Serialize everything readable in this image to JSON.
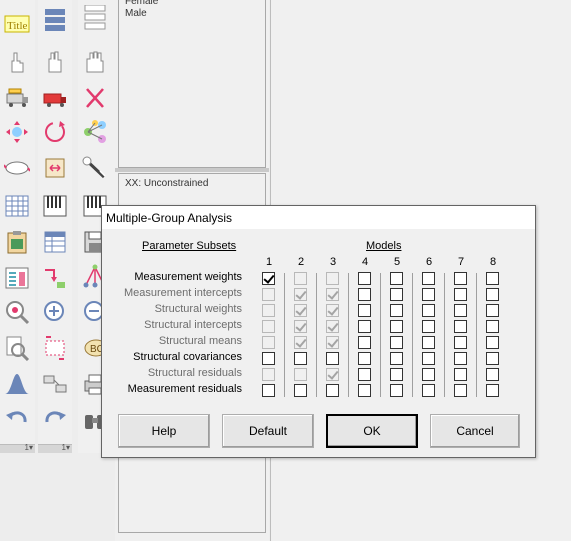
{
  "toolbox": {
    "column1_icons": [
      "title-icon",
      "hand-one-finger-icon",
      "truck-icon",
      "move-arrows-icon",
      "oval-icon",
      "table-icon",
      "clipboard-icon",
      "data-list-icon",
      "zoom-in-icon",
      "zoom-page-icon",
      "normal-curve-icon",
      "undo-icon"
    ],
    "column2_icons": [
      "list-icon",
      "hand-two-fingers-icon",
      "truck-red-icon",
      "rotate-icon",
      "scroll-icon",
      "piano-keys-icon",
      "data-sheet-icon",
      "arrows-icon",
      "zoom-plus-icon",
      "resize-icon",
      "drag-icon",
      "redo-icon"
    ],
    "column3_icons": [
      "list-icon",
      "hand-four-fingers-icon",
      "cross-icon",
      "network-icon",
      "magic-wand-icon",
      "piano-keys-icon",
      "save-icon",
      "multiple-group-icon",
      "zoom-out-icon",
      "bc-icon",
      "printer-icon",
      "binoculars-icon"
    ],
    "footer_marker": "1▾"
  },
  "variables_panel": {
    "items": [
      "Female",
      "Male"
    ]
  },
  "models_panel": {
    "label": "XX: Unconstrained"
  },
  "dialog": {
    "title": "Multiple-Group Analysis",
    "parameter_subsets_header": "Parameter Subsets",
    "models_header": "Models",
    "model_numbers": [
      "1",
      "2",
      "3",
      "4",
      "5",
      "6",
      "7",
      "8"
    ],
    "rows": [
      {
        "label": "Measurement weights",
        "enabled": true,
        "checks": [
          true,
          false,
          false,
          false,
          false,
          false,
          false,
          false
        ],
        "disabled": [
          false,
          true,
          true,
          false,
          false,
          false,
          false,
          false
        ]
      },
      {
        "label": "Measurement intercepts",
        "enabled": false,
        "checks": [
          false,
          true,
          true,
          false,
          false,
          false,
          false,
          false
        ],
        "disabled": [
          true,
          true,
          true,
          false,
          false,
          false,
          false,
          false
        ]
      },
      {
        "label": "Structural weights",
        "enabled": false,
        "checks": [
          false,
          true,
          true,
          false,
          false,
          false,
          false,
          false
        ],
        "disabled": [
          true,
          true,
          true,
          false,
          false,
          false,
          false,
          false
        ]
      },
      {
        "label": "Structural intercepts",
        "enabled": false,
        "checks": [
          false,
          true,
          true,
          false,
          false,
          false,
          false,
          false
        ],
        "disabled": [
          true,
          true,
          true,
          false,
          false,
          false,
          false,
          false
        ]
      },
      {
        "label": "Structural means",
        "enabled": false,
        "checks": [
          false,
          true,
          true,
          false,
          false,
          false,
          false,
          false
        ],
        "disabled": [
          true,
          true,
          true,
          false,
          false,
          false,
          false,
          false
        ]
      },
      {
        "label": "Structural covariances",
        "enabled": true,
        "checks": [
          false,
          false,
          false,
          false,
          false,
          false,
          false,
          false
        ],
        "disabled": [
          false,
          false,
          false,
          false,
          false,
          false,
          false,
          false
        ]
      },
      {
        "label": "Structural residuals",
        "enabled": false,
        "checks": [
          false,
          false,
          true,
          false,
          false,
          false,
          false,
          false
        ],
        "disabled": [
          true,
          true,
          true,
          false,
          false,
          false,
          false,
          false
        ]
      },
      {
        "label": "Measurement residuals",
        "enabled": true,
        "checks": [
          false,
          false,
          false,
          false,
          false,
          false,
          false,
          false
        ],
        "disabled": [
          false,
          false,
          false,
          false,
          false,
          false,
          false,
          false
        ]
      }
    ],
    "buttons": {
      "help": "Help",
      "default": "Default",
      "ok": "OK",
      "cancel": "Cancel"
    }
  }
}
